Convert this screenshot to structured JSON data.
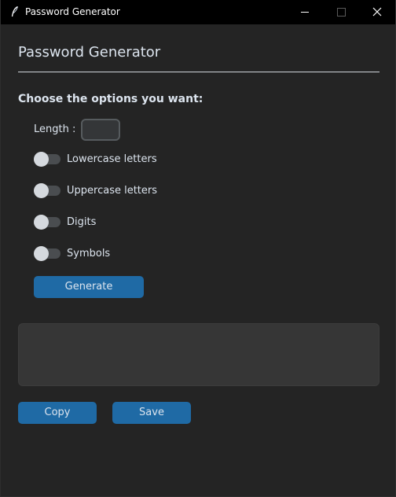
{
  "window": {
    "title": "Password Generator",
    "icon": "feather-icon"
  },
  "header": {
    "title": "Password Generator"
  },
  "options": {
    "heading": "Choose the options you want:",
    "length_label": "Length :",
    "length_value": "",
    "switches": [
      {
        "label": "Lowercase letters",
        "on": false
      },
      {
        "label": "Uppercase letters",
        "on": false
      },
      {
        "label": "Digits",
        "on": false
      },
      {
        "label": "Symbols",
        "on": false
      }
    ]
  },
  "actions": {
    "generate_label": "Generate",
    "copy_label": "Copy",
    "save_label": "Save"
  },
  "output": {
    "value": ""
  },
  "colors": {
    "background": "#242424",
    "titlebar": "#000000",
    "accent": "#1f6aa5",
    "output_box": "#363636"
  }
}
